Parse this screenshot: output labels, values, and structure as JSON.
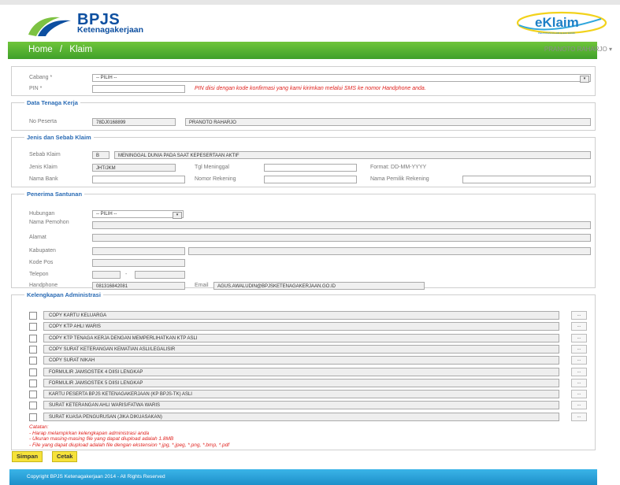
{
  "brand": {
    "name": "BPJS",
    "subtitle": "Ketenagakerjaan",
    "eklaim_logo": "eKlaim",
    "eklaim_tagline": "PELAYANAN KLAIM ELEKTRONIK"
  },
  "nav": {
    "home": "Home",
    "separator": "/",
    "current": "Klaim",
    "user": "PRANOTO RAHARJO ▾"
  },
  "top": {
    "cabang_label": "Cabang *",
    "cabang_value": "-- PILIH --",
    "pin_label": "PIN *",
    "pin_value": "",
    "pin_note": "PIN diisi dengan kode konfirmasi yang kami kirimkan melalui SMS ke nomor Handphone anda."
  },
  "tenaga": {
    "legend": "Data Tenaga Kerja",
    "no_peserta_label": "No Peserta",
    "no_peserta": "78DJ0168899",
    "nama": "PRANOTO RAHARJO"
  },
  "klaim": {
    "legend": "Jenis dan Sebab Klaim",
    "sebab_label": "Sebab Klaim",
    "sebab_code": "B",
    "sebab_desc": "MENINGGAL DUNIA PADA SAAT KEPESERTAAN AKTIF",
    "jenis_label": "Jenis Klaim",
    "jenis_value": "JHT/JKM",
    "tgl_label": "Tgl Meninggal",
    "format_label": "Format: DD-MM-YYYY",
    "bank_label": "Nama Bank",
    "rekening_label": "Nomor Rekening",
    "pemilik_label": "Nama Pemilik Rekening"
  },
  "penerima": {
    "legend": "Penerima Santunan",
    "hubungan_label": "Hubungan",
    "hubungan_value": "-- PILIH --",
    "nama_label": "Nama Pemohon",
    "alamat_label": "Alamat",
    "kabupaten_label": "Kabupaten",
    "kodepos_label": "Kode Pos",
    "telepon_label": "Telepon",
    "telepon_sep": "-",
    "hp_label": "Handphone",
    "hp_value": "081316842081",
    "email_label": "Email",
    "email_value": "AGUS.AWALUDIN@BPJSKETENAGAKERJAAN.GO.ID"
  },
  "admin": {
    "legend": "Kelengkapan Administrasi",
    "browse_label": "...",
    "docs": [
      "COPY KARTU KELUARGA",
      "COPY KTP AHLI WARIS",
      "COPY KTP TENAGA KERJA DENGAN MEMPERLIHATKAN KTP ASLI",
      "COPY SURAT KETERANGAN KEMATIAN ASLI/LEGALISIR",
      "COPY SURAT NIKAH",
      "FORMULIR JAMSOSTEK 4 DIISI LENGKAP",
      "FORMULIR JAMSOSTEK 5 DIISI LENGKAP",
      "KARTU PESERTA BPJS KETENAGAKERJAAN (KP BPJS-TK) ASLI",
      "SURAT KETERANGAN AHLI WARIS/FATWA WARIS",
      "SURAT KUASA PENGURUSAN (JIKA DIKUASAKAN)"
    ],
    "catatan_title": "Catatan:",
    "catatan": [
      "- Harap melampirkan kelengkapan administrasi anda",
      "- Ukuran masing-masing file yang dapat diupload adalah 1.8MB",
      "- File yang dapat diupload adalah file dengan ekstension *.jpg, *.jpeg, *.png, *.bmp, *.pdf"
    ]
  },
  "buttons": {
    "simpan": "Simpan",
    "cetak": "Cetak"
  },
  "footer": "Copyright BPJS Ketenagakerjaan 2014 - All Rights Reserved",
  "colors": {
    "brand_blue": "#0d4fa0",
    "nav_green": "#4caf2f",
    "legend_blue": "#2a6bb4",
    "warning_red": "#e0231f",
    "button_yellow": "#f6e23a",
    "footer_blue": "#1e8fc9"
  }
}
